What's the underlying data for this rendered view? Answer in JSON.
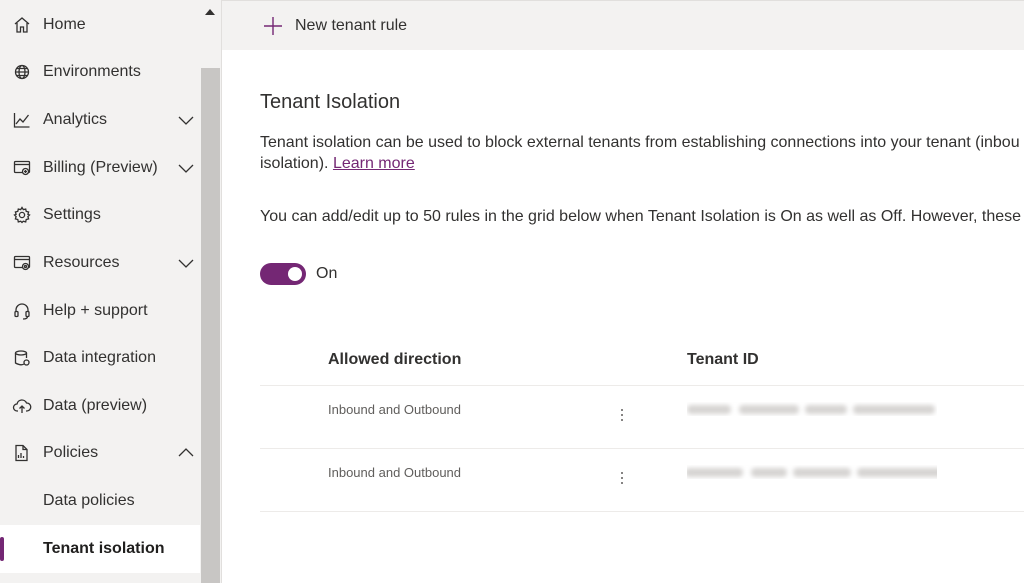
{
  "sidebar": {
    "items": [
      {
        "label": "Home",
        "icon": "home-icon",
        "expandable": false
      },
      {
        "label": "Environments",
        "icon": "globe-icon",
        "expandable": false
      },
      {
        "label": "Analytics",
        "icon": "line-chart-icon",
        "expandable": true,
        "expanded": false
      },
      {
        "label": "Billing (Preview)",
        "icon": "billing-icon",
        "expandable": true,
        "expanded": false
      },
      {
        "label": "Settings",
        "icon": "gear-icon",
        "expandable": false
      },
      {
        "label": "Resources",
        "icon": "resources-icon",
        "expandable": true,
        "expanded": false
      },
      {
        "label": "Help + support",
        "icon": "headset-icon",
        "expandable": false
      },
      {
        "label": "Data integration",
        "icon": "database-icon",
        "expandable": false
      },
      {
        "label": "Data (preview)",
        "icon": "cloud-upload-icon",
        "expandable": false
      },
      {
        "label": "Policies",
        "icon": "policy-document-icon",
        "expandable": true,
        "expanded": true
      }
    ],
    "subitems": [
      {
        "label": "Data policies",
        "selected": false
      },
      {
        "label": "Tenant isolation",
        "selected": true
      }
    ]
  },
  "command_bar": {
    "new_rule_label": "New tenant rule"
  },
  "page": {
    "title": "Tenant Isolation",
    "description_line1": "Tenant isolation can be used to block external tenants from establishing connections into your tenant (inbou",
    "description_line2": "isolation).",
    "learn_more": "Learn more",
    "note": "You can add/edit up to 50 rules in the grid below when Tenant Isolation is On as well as Off. However, these r",
    "toggle_state": "On"
  },
  "grid": {
    "columns": [
      "Allowed direction",
      "Tenant ID"
    ],
    "rows": [
      {
        "direction": "Inbound and Outbound",
        "tenant_id_redacted": true
      },
      {
        "direction": "Inbound and Outbound",
        "tenant_id_redacted": true
      }
    ]
  },
  "colors": {
    "accent": "#742774",
    "sidebar_bg": "#f3f2f1",
    "text": "#323130"
  }
}
